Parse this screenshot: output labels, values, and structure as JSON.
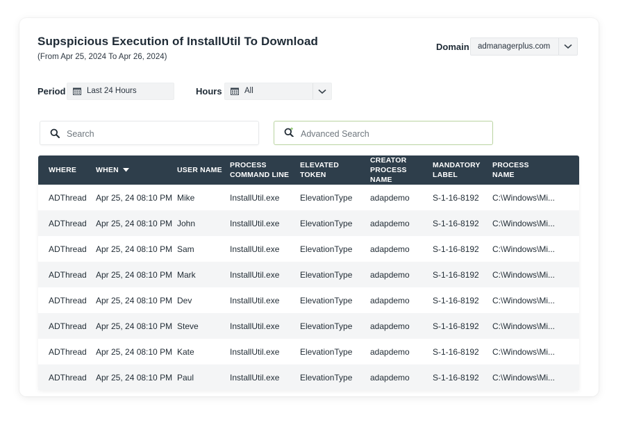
{
  "report": {
    "title": "Supspicious Execution of InstallUtil To Download",
    "date_range": "(From Apr 25, 2024 To Apr 26, 2024)"
  },
  "domain": {
    "label": "Domain",
    "value": "admanagerplus.com"
  },
  "filters": {
    "period_label": "Period",
    "period_value": "Last 24 Hours",
    "hours_label": "Hours",
    "hours_value": "All"
  },
  "search": {
    "placeholder": "Search",
    "advanced_placeholder": "Advanced Search"
  },
  "table": {
    "columns": [
      {
        "line1": "WHERE",
        "line2": ""
      },
      {
        "line1": "WHEN",
        "line2": ""
      },
      {
        "line1": "USER NAME",
        "line2": ""
      },
      {
        "line1": "PROCESS",
        "line2": "COMMAND LINE"
      },
      {
        "line1": "ELEVATED TOKEN",
        "line2": ""
      },
      {
        "line1": "CREATOR",
        "line2": "PROCESS NAME"
      },
      {
        "line1": "MANDATORY",
        "line2": "LABEL"
      },
      {
        "line1": "PROCESS",
        "line2": "NAME"
      }
    ],
    "rows": [
      [
        "ADThread",
        "Apr 25, 24 08:10 PM",
        "Mike",
        "InstallUtil.exe",
        "ElevationType",
        "adapdemo",
        "S-1-16-8192",
        "C:\\Windows\\Mi..."
      ],
      [
        "ADThread",
        "Apr 25, 24 08:10 PM",
        "John",
        "InstallUtil.exe",
        "ElevationType",
        "adapdemo",
        "S-1-16-8192",
        "C:\\Windows\\Mi..."
      ],
      [
        "ADThread",
        "Apr 25, 24 08:10 PM",
        "Sam",
        "InstallUtil.exe",
        "ElevationType",
        "adapdemo",
        "S-1-16-8192",
        "C:\\Windows\\Mi..."
      ],
      [
        "ADThread",
        "Apr 25, 24 08:10 PM",
        "Mark",
        "InstallUtil.exe",
        "ElevationType",
        "adapdemo",
        "S-1-16-8192",
        "C:\\Windows\\Mi..."
      ],
      [
        "ADThread",
        "Apr 25, 24 08:10 PM",
        "Dev",
        "InstallUtil.exe",
        "ElevationType",
        "adapdemo",
        "S-1-16-8192",
        "C:\\Windows\\Mi..."
      ],
      [
        "ADThread",
        "Apr 25, 24 08:10 PM",
        "Steve",
        "InstallUtil.exe",
        "ElevationType",
        "adapdemo",
        "S-1-16-8192",
        "C:\\Windows\\Mi..."
      ],
      [
        "ADThread",
        "Apr 25, 24 08:10 PM",
        "Kate",
        "InstallUtil.exe",
        "ElevationType",
        "adapdemo",
        "S-1-16-8192",
        "C:\\Windows\\Mi..."
      ],
      [
        "ADThread",
        "Apr 25, 24 08:10 PM",
        "Paul",
        "InstallUtil.exe",
        "ElevationType",
        "adapdemo",
        "S-1-16-8192",
        "C:\\Windows\\Mi..."
      ]
    ]
  },
  "colors": {
    "header_bg": "#2e3e4b",
    "advanced_search_border": "#b9d3a0",
    "advanced_search_plus": "#8dc26f"
  }
}
